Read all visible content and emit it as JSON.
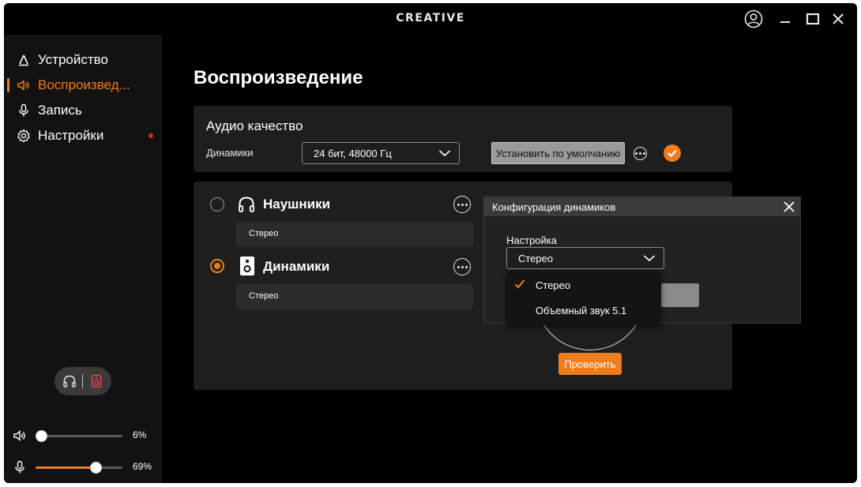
{
  "window": {
    "brand": "CREATIVE"
  },
  "sidebar": {
    "items": [
      {
        "label": "Устройство",
        "icon": "device-icon",
        "active": false
      },
      {
        "label": "Воспроизвед...",
        "icon": "speaker-volume-icon",
        "active": true
      },
      {
        "label": "Запись",
        "icon": "microphone-icon",
        "active": false
      },
      {
        "label": "Настройки",
        "icon": "gear-icon",
        "active": false,
        "notification": true
      }
    ],
    "output_toggle": {
      "left_icon": "headphones-icon",
      "right_icon": "speaker-icon",
      "selected": "speaker"
    },
    "volume": {
      "icon": "speaker-volume-icon",
      "value": 6,
      "label": "6%"
    },
    "mic": {
      "icon": "microphone-icon",
      "value": 69,
      "label": "69%"
    }
  },
  "main": {
    "title": "Воспроизведение",
    "audio_quality": {
      "title": "Аудио качество",
      "field_label": "Динамики",
      "format_value": "24 бит, 48000 Гц",
      "set_default_label": "Установить по умолчанию"
    },
    "devices": [
      {
        "name": "Наушники",
        "config": "Стерео",
        "selected": false,
        "icon": "headphones-icon"
      },
      {
        "name": "Динамики",
        "config": "Стерео",
        "selected": true,
        "icon": "speaker-icon"
      }
    ],
    "test_button": "Проверить"
  },
  "dialog": {
    "title": "Конфигурация динамиков",
    "field_label": "Настройка",
    "selected": "Стерео",
    "options": [
      {
        "label": "Стерео",
        "checked": true
      },
      {
        "label": "Объемный звук 5.1",
        "checked": false
      }
    ]
  },
  "colors": {
    "accent": "#f07d1b",
    "background": "#000000",
    "sidebar": "#121212",
    "card": "#1e1e1e",
    "notification": "#e8231f"
  }
}
